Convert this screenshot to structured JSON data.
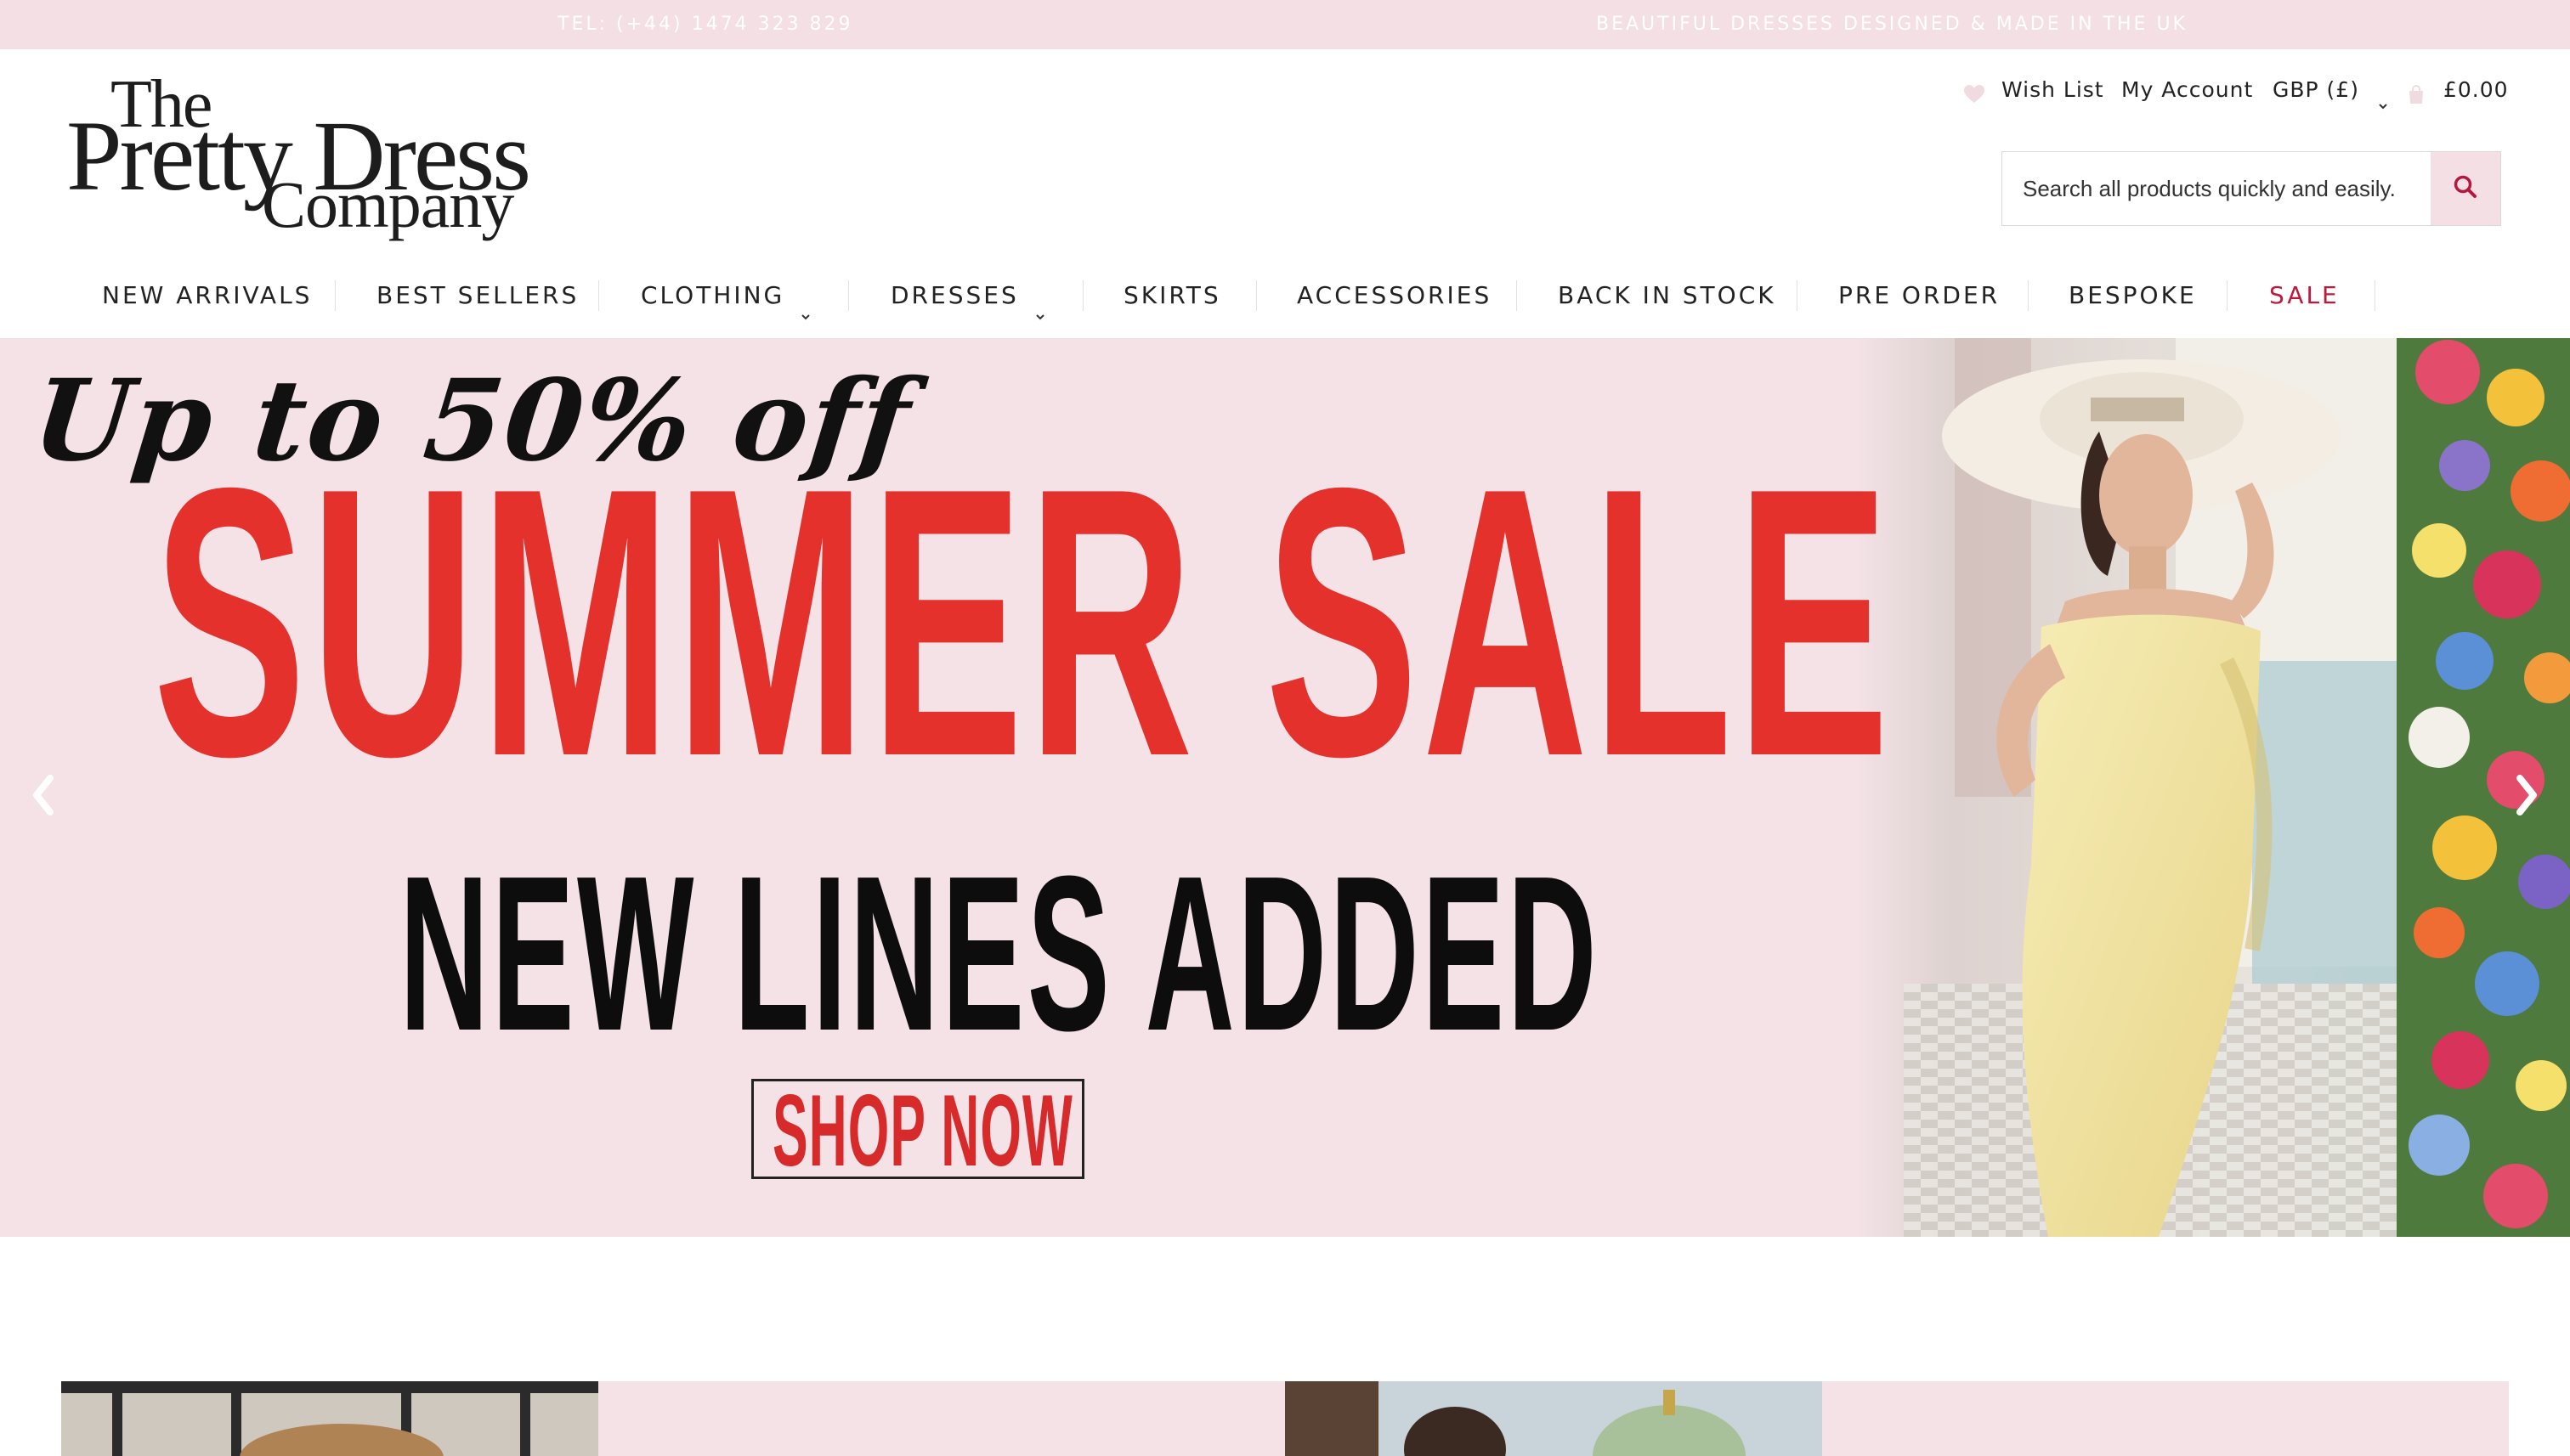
{
  "topbar": {
    "phone": "TEL: (+44) 1474 323 829",
    "tagline": "BEAUTIFUL DRESSES DESIGNED & MADE IN THE UK"
  },
  "logo": {
    "line1": "The",
    "line2": "Pretty Dress",
    "line3": "Company"
  },
  "utility": {
    "wishlist": "Wish List",
    "account": "My Account",
    "currency": "GBP (£)",
    "cart_total": "£0.00"
  },
  "search": {
    "placeholder": "Search all products quickly and easily."
  },
  "nav": {
    "items": [
      {
        "label": "NEW ARRIVALS"
      },
      {
        "label": "BEST SELLERS"
      },
      {
        "label": "CLOTHING"
      },
      {
        "label": "DRESSES"
      },
      {
        "label": "SKIRTS"
      },
      {
        "label": "ACCESSORIES"
      },
      {
        "label": "BACK IN STOCK"
      },
      {
        "label": "PRE ORDER"
      },
      {
        "label": "BESPOKE"
      },
      {
        "label": "SALE"
      }
    ]
  },
  "hero": {
    "line1": "Up to 50% off",
    "line2": "SUMMER SALE",
    "line3": "NEW LINES ADDED",
    "cta": "SHOP NOW"
  },
  "colors": {
    "topbar_bg": "#f3dfe4",
    "hero_bg": "#f4e2e7",
    "sale_red": "#c0183a",
    "promo_red": "#e4312b"
  },
  "icons": [
    "heart-icon",
    "bag-icon",
    "chevron-down-icon",
    "search-icon",
    "chevron-left-icon",
    "chevron-right-icon"
  ]
}
